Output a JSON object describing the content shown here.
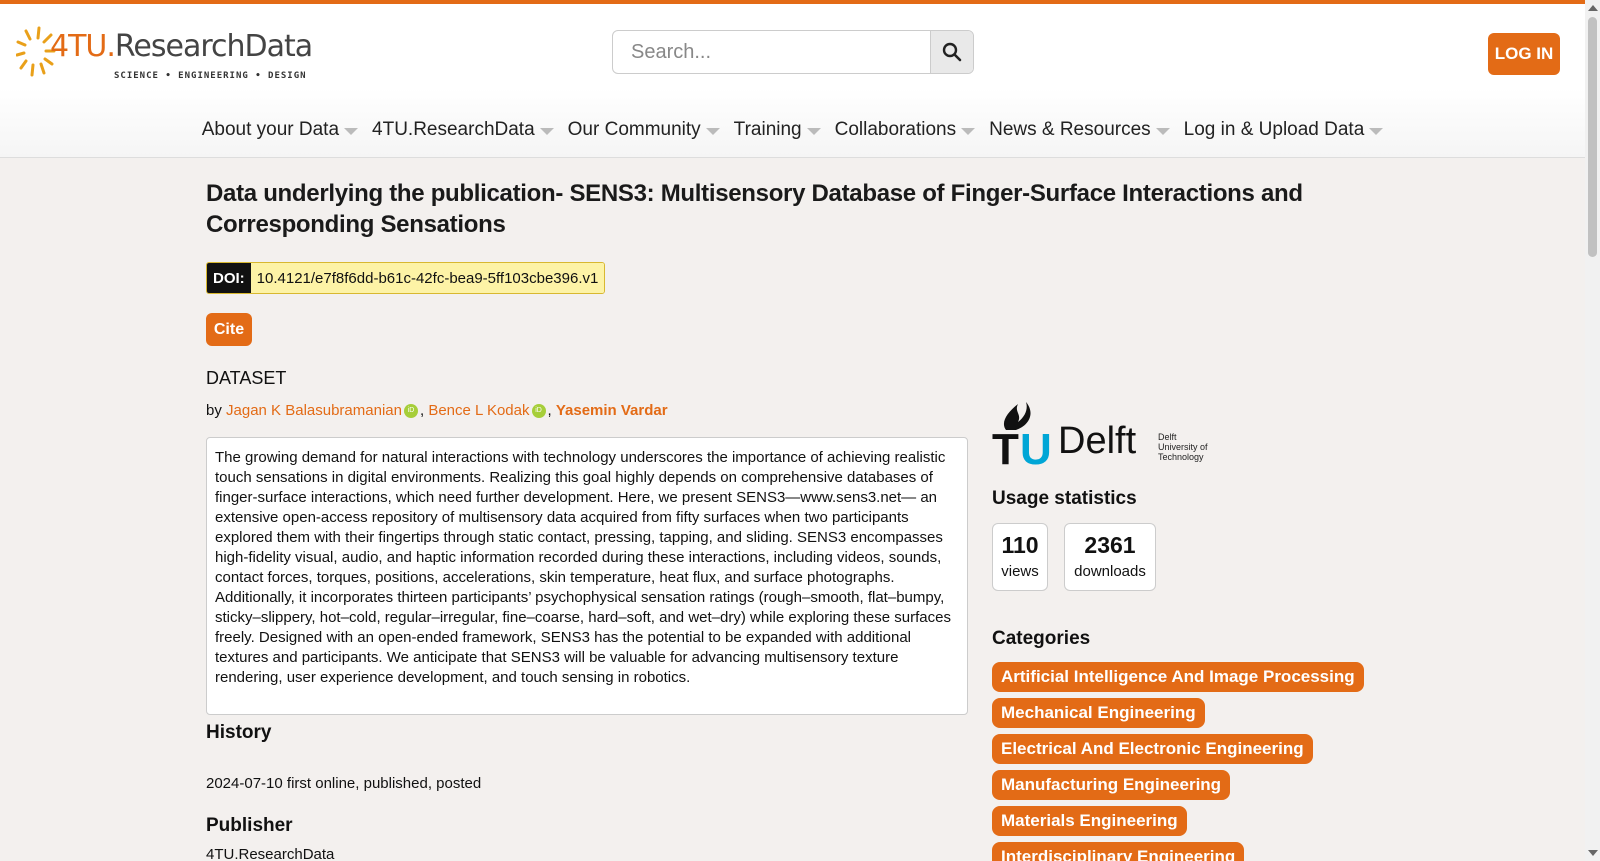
{
  "header": {
    "logo_main": "4TU.",
    "logo_rd": "ResearchData",
    "logo_tagline": "SCIENCE • ENGINEERING • DESIGN",
    "search_placeholder": "Search...",
    "login_label": "LOG IN"
  },
  "nav": {
    "items": [
      {
        "label": "About your Data"
      },
      {
        "label": "4TU.ResearchData"
      },
      {
        "label": "Our Community"
      },
      {
        "label": "Training"
      },
      {
        "label": "Collaborations"
      },
      {
        "label": "News & Resources"
      },
      {
        "label": "Log in & Upload Data"
      }
    ]
  },
  "dataset": {
    "title": "Data underlying the publication- SENS3: Multisensory Database of Finger-Surface Interactions and Corresponding Sensations",
    "doi_label": "DOI:",
    "doi_value": "10.4121/e7f8f6dd-b61c-42fc-bea9-5ff103cbe396.v1",
    "cite_label": "Cite",
    "type_label": "DATASET",
    "by": "by",
    "authors": [
      {
        "name": "Jagan K Balasubramanian",
        "orcid": true
      },
      {
        "name": "Bence L Kodak",
        "orcid": true
      },
      {
        "name": "Yasemin Vardar",
        "orcid": false
      }
    ],
    "abstract": "The growing demand for natural interactions with technology underscores the importance of achieving realistic touch sensations in digital environments. Realizing this goal highly depends on comprehensive databases of finger-surface interactions, which need further development. Here, we present SENS3—www.sens3.net— an extensive open-access repository of multisensory data acquired from fifty surfaces when two participants explored them with their fingertips through static contact, pressing, tapping, and sliding. SENS3 encompasses high-fidelity visual, audio, and haptic information recorded during these interactions, including videos, sounds, contact forces, torques, positions, accelerations, skin temperature, heat flux, and surface photographs. Additionally, it incorporates thirteen participants’ psychophysical sensation ratings (rough–smooth, flat–bumpy, sticky–slippery, hot–cold, regular–irregular, fine–coarse, hard–soft, and wet–dry) while exploring these surfaces freely. Designed with an open-ended framework, SENS3 has the potential to be expanded with additional textures and participants. We anticipate that SENS3 will be valuable for advancing multisensory texture rendering, user experience development, and touch sensing in robotics.",
    "history_heading": "History",
    "history_text": "2024-07-10 first online, published, posted",
    "publisher_heading": "Publisher",
    "publisher_text": "4TU.ResearchData"
  },
  "sidebar": {
    "institution_logo": {
      "tu": "TU",
      "delft": "Delft",
      "small_1": "Delft",
      "small_2": "University of",
      "small_3": "Technology"
    },
    "usage_heading": "Usage statistics",
    "views_value": "110",
    "views_label": "views",
    "downloads_value": "2361",
    "downloads_label": "downloads",
    "categories_heading": "Categories",
    "categories": [
      "Artificial Intelligence And Image Processing",
      "Mechanical Engineering",
      "Electrical And Electronic Engineering",
      "Manufacturing Engineering",
      "Materials Engineering",
      "Interdisciplinary Engineering"
    ]
  },
  "colors": {
    "accent": "#e36b16",
    "doi_bg": "#fdf3a6",
    "orcid": "#a6ce39",
    "tu_blue": "#00a6d6"
  }
}
